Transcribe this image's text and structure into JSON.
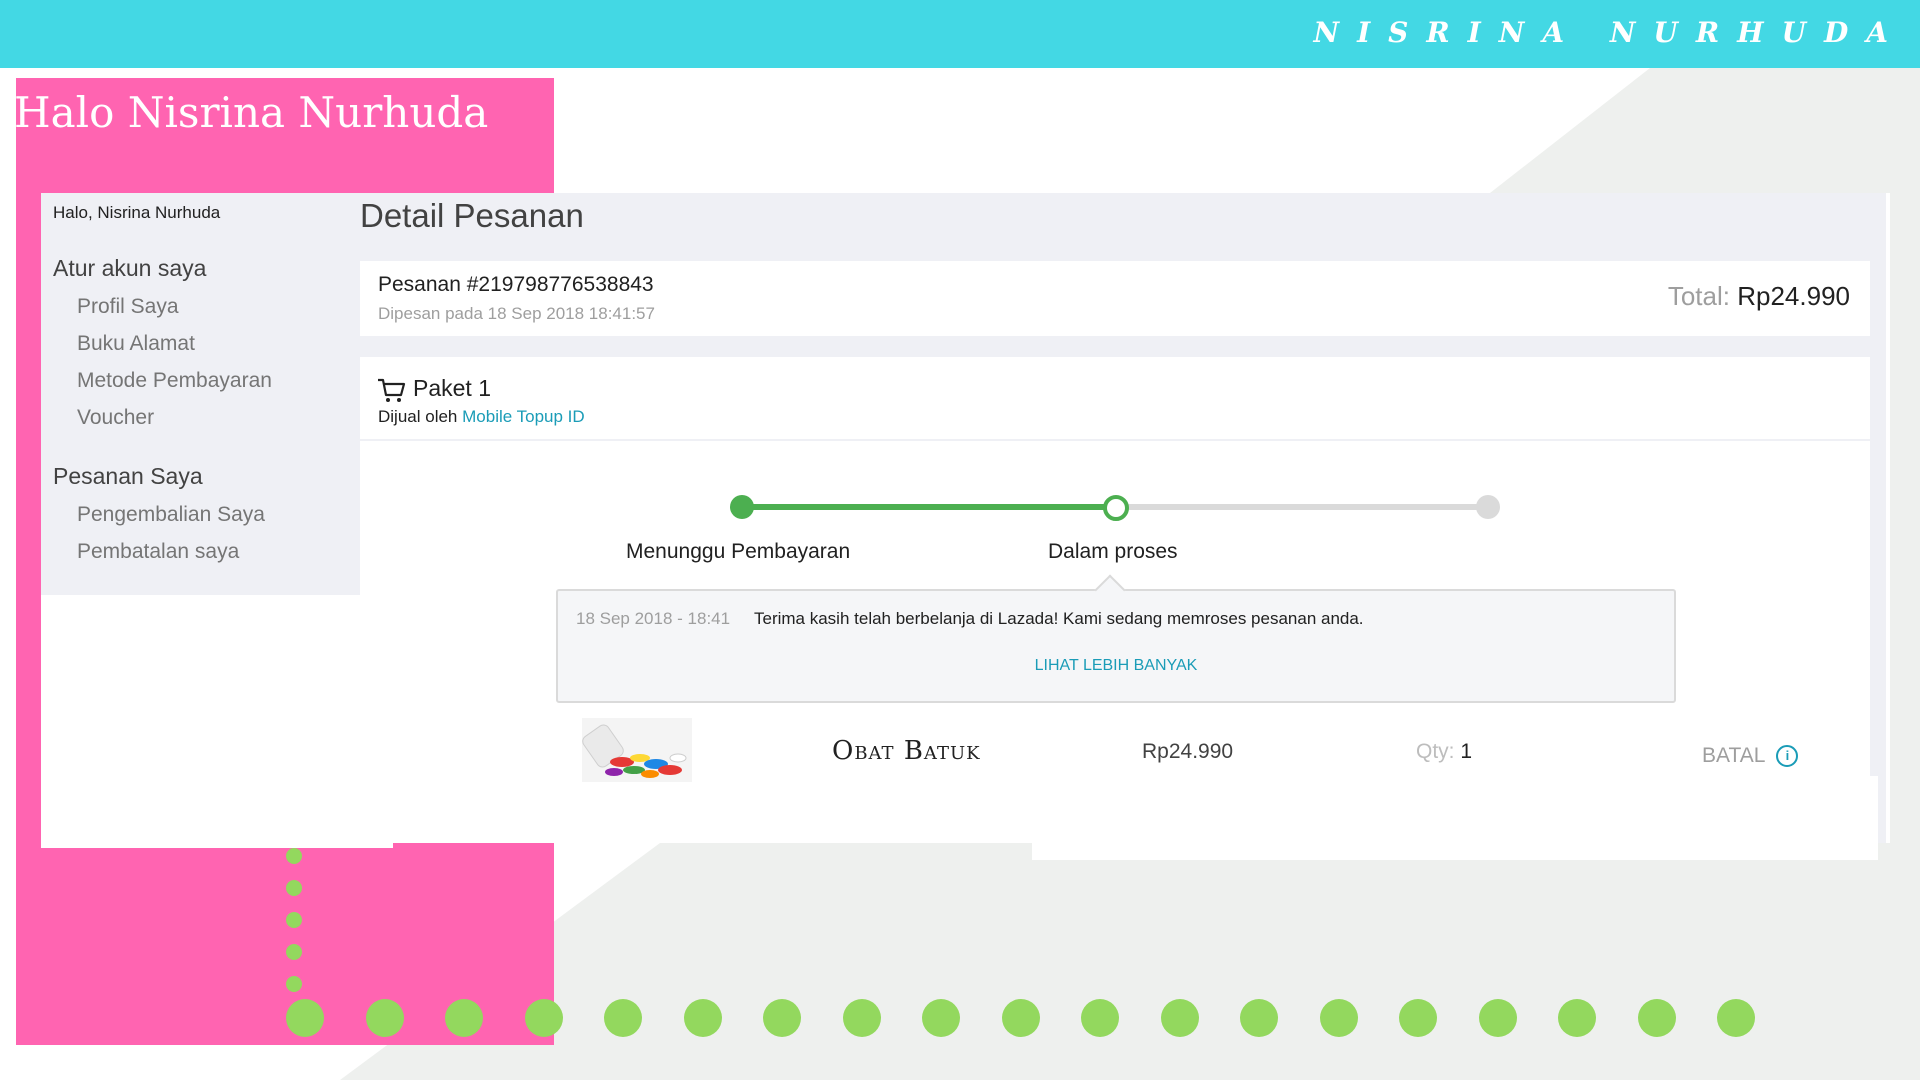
{
  "header": {
    "brand": "NISRINA NURHUDA"
  },
  "greeting_banner": "Halo Nisrina Nurhuda",
  "colors": {
    "topbar": "#43d8e4",
    "pink": "#ff64b1",
    "dots": "#93d85e",
    "accent_link": "#1a9cb7",
    "progress_done": "#4caf50"
  },
  "sidebar": {
    "hello": "Halo, Nisrina Nurhuda",
    "section1": "Atur akun saya",
    "items1": [
      "Profil Saya",
      "Buku Alamat",
      "Metode Pembayaran",
      "Voucher"
    ],
    "section2": "Pesanan Saya",
    "items2": [
      "Pengembalian Saya",
      "Pembatalan saya"
    ]
  },
  "main": {
    "title": "Detail Pesanan",
    "order": {
      "number": "Pesanan #219798776538843",
      "date": "Dipesan pada 18 Sep 2018 18:41:57",
      "total_label": "Total:",
      "total_value": "Rp24.990"
    },
    "package": {
      "title": "Paket 1",
      "seller_prefix": "Dijual oleh",
      "seller_name": "Mobile Topup ID",
      "icon": "cart-icon"
    },
    "progress": {
      "steps": [
        "Menunggu Pembayaran",
        "Dalam proses",
        ""
      ],
      "current_step": 2
    },
    "history": {
      "time": "18 Sep 2018 - 18:41",
      "message": "Terima kasih telah berbelanja di Lazada! Kami sedang memroses pesanan anda.",
      "more_link": "LIHAT LEBIH BANYAK"
    },
    "item": {
      "name": "Obat Batuk",
      "price": "Rp24.990",
      "qty_label": "Qty:",
      "qty_value": "1",
      "action": "BATAL",
      "action_icon": "info-icon"
    }
  }
}
